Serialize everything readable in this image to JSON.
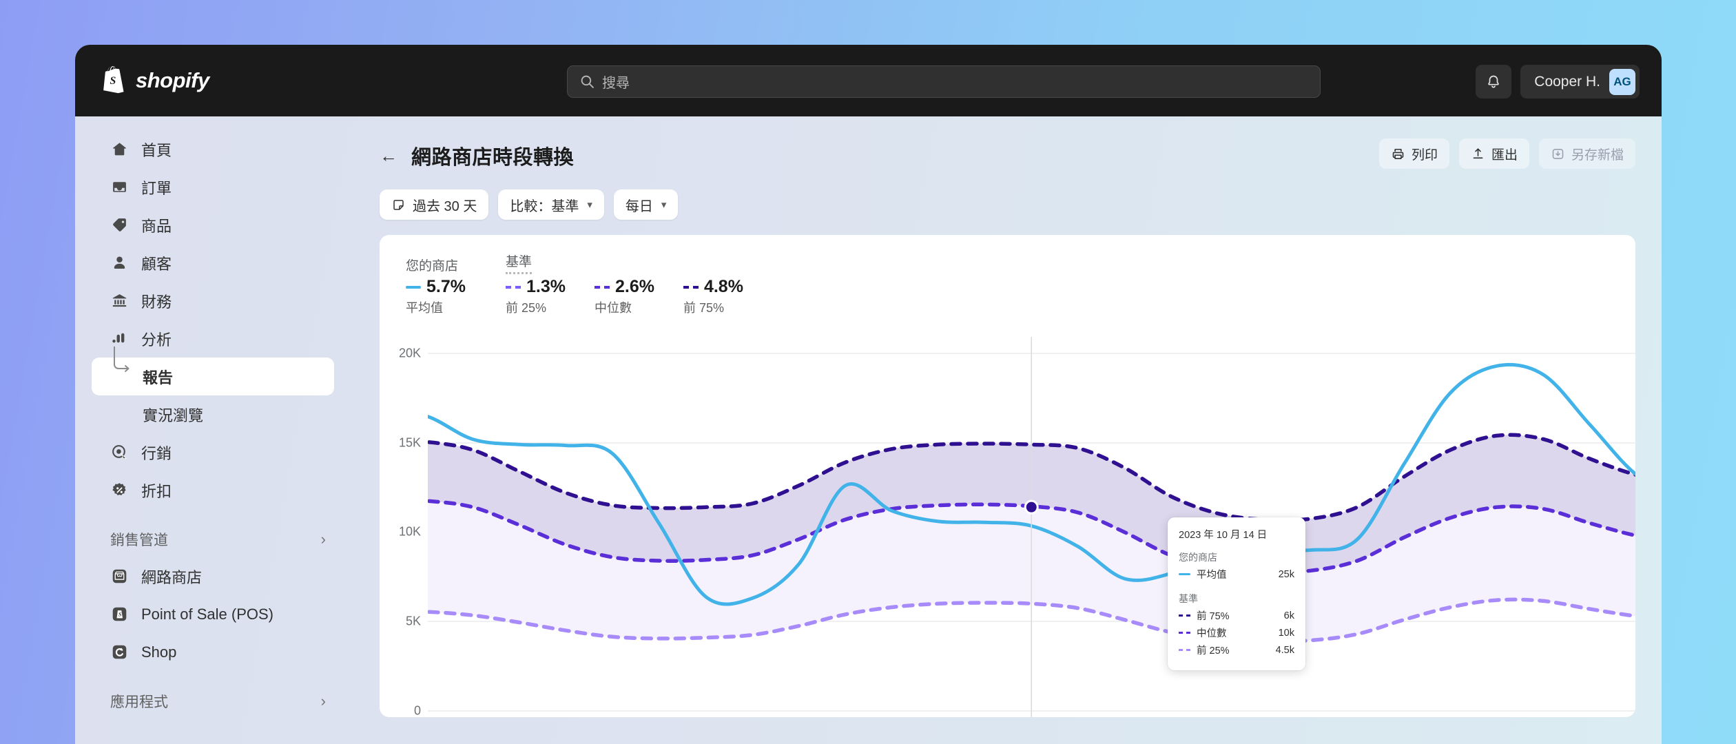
{
  "topbar": {
    "brand": "shopify",
    "search_placeholder": "搜尋",
    "notifications_icon": "bell-icon",
    "user_name": "Cooper H.",
    "avatar_initials": "AG"
  },
  "sidebar": {
    "items": [
      {
        "label": "首頁",
        "icon": "home-icon",
        "active": false
      },
      {
        "label": "訂單",
        "icon": "orders-inbox-icon",
        "active": false
      },
      {
        "label": "商品",
        "icon": "product-tag-icon",
        "active": false
      },
      {
        "label": "顧客",
        "icon": "customer-person-icon",
        "active": false
      },
      {
        "label": "財務",
        "icon": "finance-bank-icon",
        "active": false
      },
      {
        "label": "分析",
        "icon": "analytics-bars-icon",
        "active": false
      },
      {
        "label": "報告",
        "icon": "branch-arrow-icon",
        "active": true
      },
      {
        "label": "實況瀏覽",
        "icon": "",
        "active": false
      },
      {
        "label": "行銷",
        "icon": "marketing-target-icon",
        "active": false
      },
      {
        "label": "折扣",
        "icon": "discount-badge-icon",
        "active": false
      }
    ],
    "sales_channels": {
      "label": "銷售管道",
      "chevron": "chevron-right-icon",
      "items": [
        {
          "label": "網路商店",
          "icon": "online-store-icon"
        },
        {
          "label": "Point of Sale (POS)",
          "icon": "pos-icon"
        },
        {
          "label": "Shop",
          "icon": "shop-icon"
        }
      ]
    },
    "apps": {
      "label": "應用程式",
      "chevron": "chevron-right-icon"
    }
  },
  "page": {
    "back_icon": "back-arrow-icon",
    "title": "網路商店時段轉換",
    "actions": [
      {
        "label": "列印",
        "icon": "printer-icon",
        "disabled": false
      },
      {
        "label": "匯出",
        "icon": "export-upload-icon",
        "disabled": false
      },
      {
        "label": "另存新檔",
        "icon": "save-download-icon",
        "disabled": true
      }
    ],
    "filters": [
      {
        "label": "過去 30 天",
        "icon": "calendar-icon",
        "chevron": false
      },
      {
        "label": "比較：基準",
        "icon": "",
        "chevron": true
      },
      {
        "label": "每日",
        "icon": "",
        "chevron": true
      }
    ]
  },
  "chart_data": {
    "type": "line",
    "title": "網路商店時段轉換",
    "xlabel": "",
    "ylabel": "",
    "ylim": [
      0,
      20000
    ],
    "ytick_labels": [
      "20K",
      "15K",
      "10K",
      "5K",
      "0"
    ],
    "ytick_values": [
      20000,
      15000,
      10000,
      5000,
      0
    ],
    "grid": true,
    "legend_position": "top-left",
    "legend_groups": [
      {
        "title": "您的商店",
        "dotted_underline": false,
        "entries": [
          {
            "value": "5.7%",
            "label": "平均值",
            "style": "solid",
            "color": "#41b3e8"
          }
        ]
      },
      {
        "title": "基準",
        "dotted_underline": true,
        "entries": [
          {
            "value": "1.3%",
            "label": "前 25%",
            "style": "dashed",
            "color": "#7c5cff"
          },
          {
            "value": "2.6%",
            "label": "中位數",
            "style": "dashed",
            "color": "#5b2fd8"
          },
          {
            "value": "4.8%",
            "label": "前 75%",
            "style": "dashed",
            "color": "#2f1090"
          }
        ]
      }
    ],
    "series": [
      {
        "name": "平均值",
        "group": "您的商店",
        "style": "solid",
        "color": "#41b3e8",
        "values": [
          16800,
          16500,
          15200,
          14900,
          14850,
          14400,
          10500,
          6400,
          6300,
          8200,
          12600,
          11200,
          10600,
          10550,
          10350,
          9200,
          7400,
          7700,
          8900,
          9100,
          9000,
          9600,
          13800,
          17800,
          19300,
          18800,
          16000,
          13200,
          11900,
          11500
        ]
      },
      {
        "name": "前 75%",
        "group": "基準",
        "style": "dashed",
        "color": "#2f1090",
        "values": [
          15100,
          15050,
          14600,
          13400,
          12200,
          11500,
          11350,
          11400,
          11600,
          12600,
          13900,
          14650,
          14900,
          14950,
          14900,
          14700,
          13600,
          12000,
          11050,
          10700,
          10750,
          11400,
          13100,
          14600,
          15400,
          15200,
          14100,
          13200,
          12700,
          12600
        ]
      },
      {
        "name": "中位數",
        "group": "基準",
        "style": "dashed",
        "color": "#5b2fd8",
        "values": [
          11800,
          11750,
          11400,
          10400,
          9300,
          8600,
          8400,
          8450,
          8700,
          9600,
          10700,
          11300,
          11500,
          11550,
          11450,
          11100,
          10000,
          8700,
          8000,
          7800,
          7850,
          8400,
          9700,
          10800,
          11400,
          11300,
          10500,
          9800,
          9400,
          9300
        ]
      },
      {
        "name": "前 25%",
        "group": "基準",
        "style": "dashed",
        "color": "#a78bfa",
        "values": [
          5600,
          5550,
          5350,
          4950,
          4500,
          4150,
          4050,
          4100,
          4250,
          4750,
          5400,
          5800,
          6000,
          6050,
          6000,
          5750,
          5100,
          4400,
          4000,
          3900,
          3950,
          4300,
          5100,
          5800,
          6200,
          6150,
          5700,
          5300,
          5050,
          5000
        ]
      }
    ],
    "band_upper_series": "前 75%",
    "band_mid_series": "中位數",
    "band_lower_series": "前 25%",
    "band_upper_fill": "#ddd7ed",
    "band_lower_fill": "#f5f2fd",
    "highlight_point": {
      "series": "前 75%",
      "value": 11400,
      "color": "#2f1090"
    },
    "tooltip": {
      "date": "2023 年 10 月 14 日",
      "sections": [
        {
          "heading": "您的商店",
          "rows": [
            {
              "label": "平均值",
              "value": "25k",
              "style": "solid",
              "color": "#41b3e8"
            }
          ]
        },
        {
          "heading": "基準",
          "rows": [
            {
              "label": "前 75%",
              "value": "6k",
              "style": "dashed",
              "color": "#2f1090"
            },
            {
              "label": "中位數",
              "value": "10k",
              "style": "dashed",
              "color": "#5b2fd8"
            },
            {
              "label": "前 25%",
              "value": "4.5k",
              "style": "dashed",
              "color": "#a78bfa"
            }
          ]
        }
      ]
    }
  }
}
